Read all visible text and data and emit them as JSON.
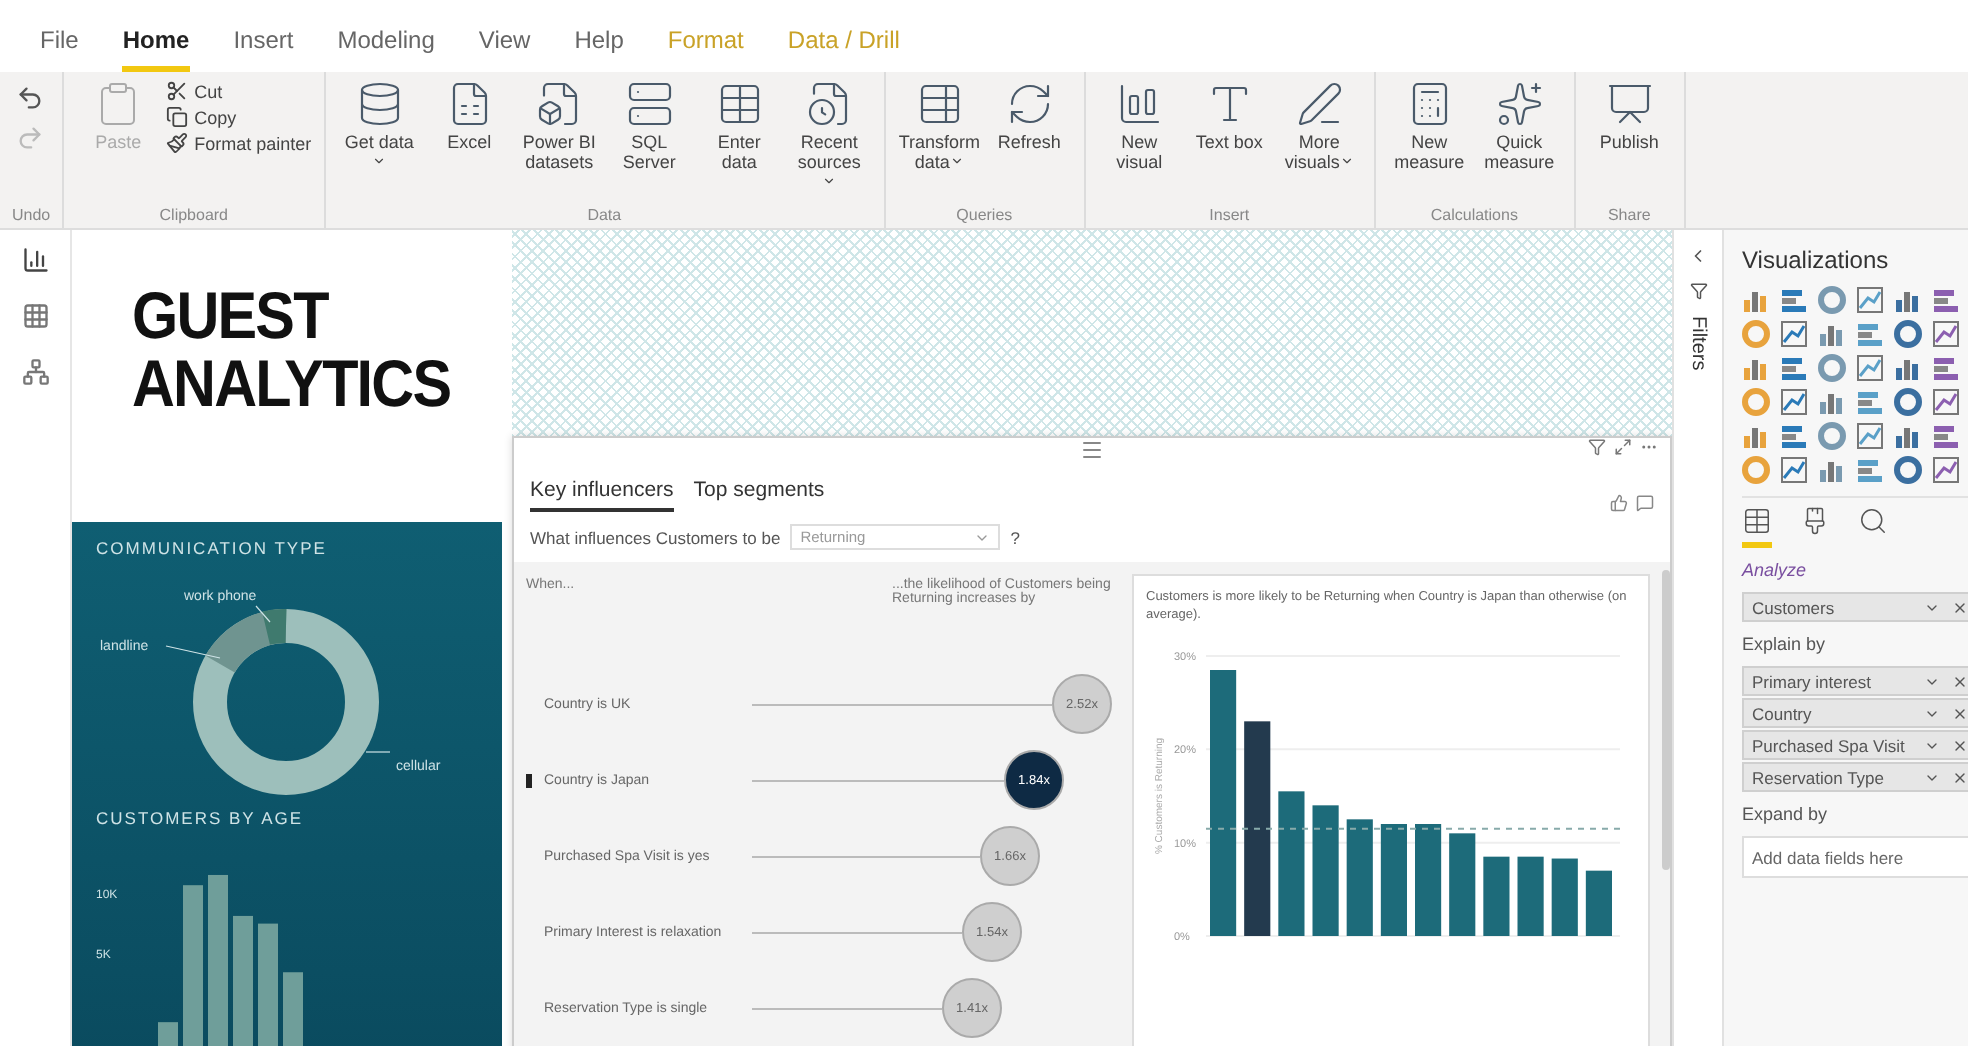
{
  "ribbon_tabs": [
    {
      "label": "File",
      "selected": false,
      "kind": "standard"
    },
    {
      "label": "Home",
      "selected": true,
      "kind": "standard"
    },
    {
      "label": "Insert",
      "selected": false,
      "kind": "standard"
    },
    {
      "label": "Modeling",
      "selected": false,
      "kind": "standard"
    },
    {
      "label": "View",
      "selected": false,
      "kind": "standard"
    },
    {
      "label": "Help",
      "selected": false,
      "kind": "standard"
    },
    {
      "label": "Format",
      "selected": false,
      "kind": "contextual"
    },
    {
      "label": "Data / Drill",
      "selected": false,
      "kind": "contextual"
    }
  ],
  "ribbon_groups": [
    {
      "label": "Undo",
      "buttons": [
        {
          "kind": "icon",
          "disabled": false
        },
        {
          "kind": "icon",
          "disabled": true
        }
      ]
    },
    {
      "label": "Clipboard",
      "buttons": [
        {
          "kind": "large",
          "label": "Paste",
          "disabled": true
        },
        {
          "kind": "small",
          "label": "Cut",
          "disabled": false
        },
        {
          "kind": "small",
          "label": "Copy",
          "disabled": false
        },
        {
          "kind": "small",
          "label": "Format painter",
          "disabled": false
        }
      ]
    },
    {
      "label": "Data",
      "buttons": [
        {
          "kind": "large",
          "label": "Get data",
          "dropdown": true,
          "disabled": false
        },
        {
          "kind": "large",
          "label": "Excel",
          "disabled": false
        },
        {
          "kind": "large",
          "label": "Power BI datasets",
          "disabled": false
        },
        {
          "kind": "large",
          "label": "SQL Server",
          "disabled": false
        },
        {
          "kind": "large",
          "label": "Enter data",
          "disabled": false
        },
        {
          "kind": "large",
          "label": "Recent sources",
          "dropdown": true,
          "disabled": false
        }
      ]
    },
    {
      "label": "Queries",
      "buttons": [
        {
          "kind": "large",
          "label": "Transform data",
          "dropdown": true,
          "disabled": false
        },
        {
          "kind": "large",
          "label": "Refresh",
          "disabled": false
        }
      ]
    },
    {
      "label": "Insert",
      "buttons": [
        {
          "kind": "large",
          "label": "New visual",
          "disabled": false
        },
        {
          "kind": "large",
          "label": "Text box",
          "disabled": false
        },
        {
          "kind": "large",
          "label": "More visuals",
          "dropdown": true,
          "disabled": false
        }
      ]
    },
    {
      "label": "Calculations",
      "buttons": [
        {
          "kind": "large",
          "label": "New measure",
          "disabled": false
        },
        {
          "kind": "large",
          "label": "Quick measure",
          "disabled": false
        }
      ]
    },
    {
      "label": "Share",
      "buttons": [
        {
          "kind": "large",
          "label": "Publish",
          "disabled": false
        }
      ]
    }
  ],
  "report_title": [
    "GUEST",
    "ANALYTICS"
  ],
  "communication_type": {
    "title": "COMMUNICATION TYPE",
    "labels": [
      "work phone",
      "landline",
      "cellular"
    ]
  },
  "customers_by_age": {
    "title": "CUSTOMERS BY AGE",
    "tick_labels": [
      "10K",
      "5K"
    ]
  },
  "key_influencers": {
    "tabs": [
      {
        "label": "Key influencers",
        "selected": true
      },
      {
        "label": "Top segments",
        "selected": false
      }
    ],
    "question": "What influences Customers to be",
    "answer": "Returning",
    "help": "?",
    "when_header": "When...",
    "likelihood_header": "...the likelihood of Customers being Returning increases by",
    "influencers": [
      {
        "label": "Country is UK",
        "value": "2.52x",
        "selected": false
      },
      {
        "label": "Country is Japan",
        "value": "1.84x",
        "selected": true
      },
      {
        "label": "Purchased Spa Visit is yes",
        "value": "1.66x",
        "selected": false
      },
      {
        "label": "Primary Interest is relaxation",
        "value": "1.54x",
        "selected": false
      },
      {
        "label": "Reservation Type is single",
        "value": "1.41x",
        "selected": false
      }
    ],
    "detail": {
      "text": "Customers is more likely to be Returning when Country is Japan than otherwise (on average).",
      "chart_data": {
        "type": "bar",
        "ylabel": "% Customers is Returning",
        "ylim": [
          0,
          30
        ],
        "yticks": [
          {
            "value": 0,
            "label": "0%"
          },
          {
            "value": 10,
            "label": "10%"
          },
          {
            "value": 20,
            "label": "20%"
          },
          {
            "value": 30,
            "label": "30%"
          }
        ],
        "series": [
          {
            "color": "#233a4e",
            "values": [
              null,
              23,
              null,
              null,
              null,
              null,
              null,
              null,
              null,
              null,
              null,
              null
            ]
          },
          {
            "color": "#1d6b7a",
            "values": [
              28.5,
              null,
              15.5,
              14,
              12.5,
              12,
              12,
              11,
              8.5,
              8.5,
              8.3,
              7
            ]
          }
        ],
        "ref_lines": [
          {
            "axis": "y",
            "value": 11.5
          }
        ]
      }
    }
  },
  "filters": {
    "label": "Filters"
  },
  "visualizations": {
    "title": "Visualizations",
    "pane_tabs": [
      {
        "selected": true
      },
      {
        "selected": false
      },
      {
        "selected": false
      }
    ],
    "section_label": "Analyze",
    "analyze_field": "Customers",
    "explain_by": "Explain by",
    "explain_fields": [
      "Primary interest",
      "Country",
      "Purchased Spa Visit",
      "Reservation Type"
    ],
    "expand_by": "Expand by",
    "expand_placeholder": "Add data fields here"
  }
}
